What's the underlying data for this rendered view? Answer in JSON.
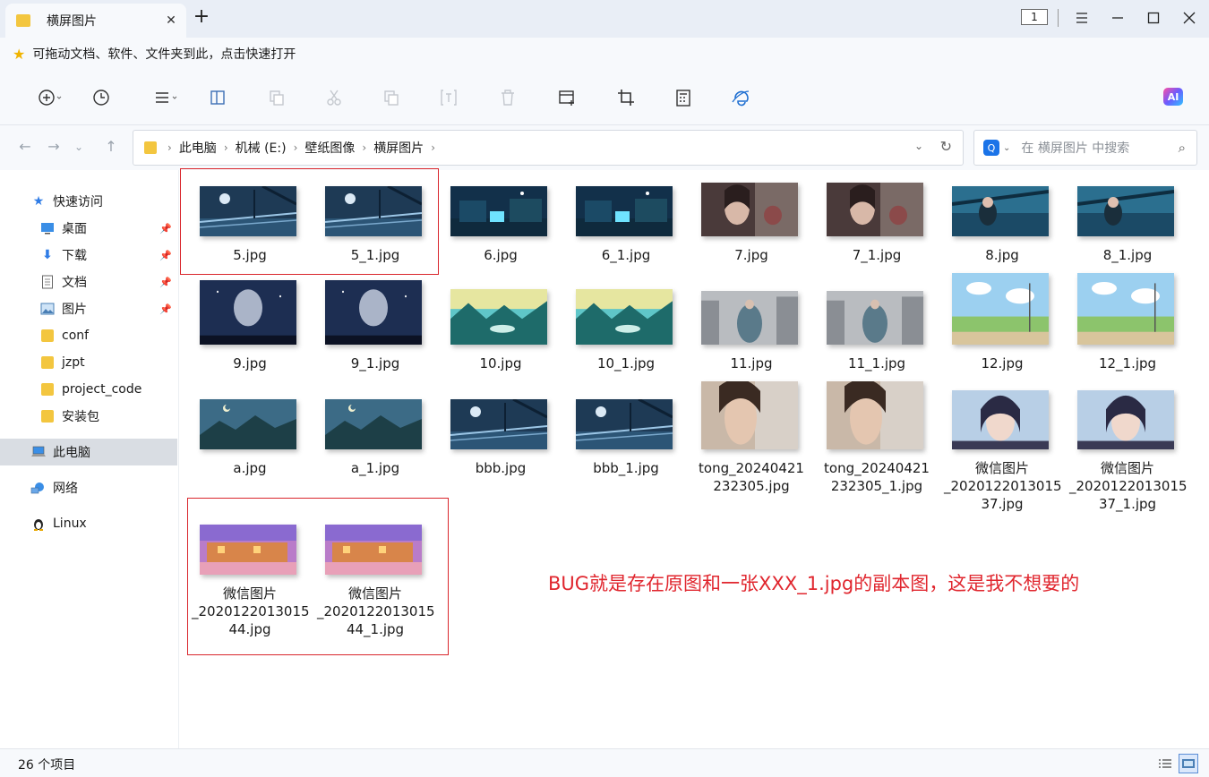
{
  "window": {
    "tab_title": "横屏图片",
    "page_counter": "1"
  },
  "quickbar": {
    "text": "可拖动文档、软件、文件夹到此，点击快速打开"
  },
  "toolbar": {
    "icons": [
      "new-icon",
      "history-icon",
      "view-menu-icon",
      "preview-pane-icon",
      "copy-icon",
      "cut-icon",
      "paste-icon",
      "rename-icon",
      "delete-icon",
      "new-window-icon",
      "crop-icon",
      "calculator-icon",
      "browser-icon"
    ],
    "ai_label": "AI"
  },
  "address": {
    "crumbs": [
      "此电脑",
      "机械 (E:)",
      "壁纸图像",
      "横屏图片"
    ],
    "search_placeholder": "在 横屏图片 中搜索"
  },
  "sidebar": {
    "items": [
      {
        "label": "快速访问",
        "icon": "star-icon"
      },
      {
        "label": "桌面",
        "icon": "desktop-icon",
        "pinned": true
      },
      {
        "label": "下载",
        "icon": "download-icon",
        "pinned": true
      },
      {
        "label": "文档",
        "icon": "document-icon",
        "pinned": true
      },
      {
        "label": "图片",
        "icon": "picture-icon",
        "pinned": true
      },
      {
        "label": "conf",
        "icon": "folder-icon"
      },
      {
        "label": "jzpt",
        "icon": "folder-icon"
      },
      {
        "label": "project_code",
        "icon": "folder-icon"
      },
      {
        "label": "安装包",
        "icon": "folder-icon"
      },
      {
        "label": "此电脑",
        "icon": "computer-icon",
        "selected": true
      },
      {
        "label": "网络",
        "icon": "network-icon"
      },
      {
        "label": "Linux",
        "icon": "linux-icon"
      }
    ]
  },
  "files": [
    {
      "name": "5.jpg",
      "theme": "train"
    },
    {
      "name": "5_1.jpg",
      "theme": "train"
    },
    {
      "name": "6.jpg",
      "theme": "night-street"
    },
    {
      "name": "6_1.jpg",
      "theme": "night-street"
    },
    {
      "name": "7.jpg",
      "theme": "girl-mech"
    },
    {
      "name": "7_1.jpg",
      "theme": "girl-mech"
    },
    {
      "name": "8.jpg",
      "theme": "blue-girl"
    },
    {
      "name": "8_1.jpg",
      "theme": "blue-girl"
    },
    {
      "name": "9.jpg",
      "theme": "moon"
    },
    {
      "name": "9_1.jpg",
      "theme": "moon"
    },
    {
      "name": "10.jpg",
      "theme": "lake"
    },
    {
      "name": "10_1.jpg",
      "theme": "lake"
    },
    {
      "name": "11.jpg",
      "theme": "city-girl"
    },
    {
      "name": "11_1.jpg",
      "theme": "city-girl"
    },
    {
      "name": "12.jpg",
      "theme": "sky-field"
    },
    {
      "name": "12_1.jpg",
      "theme": "sky-field"
    },
    {
      "name": "a.jpg",
      "theme": "mountain"
    },
    {
      "name": "a_1.jpg",
      "theme": "mountain"
    },
    {
      "name": "bbb.jpg",
      "theme": "train"
    },
    {
      "name": "bbb_1.jpg",
      "theme": "train"
    },
    {
      "name": "tong_20240421\n232305.jpg",
      "theme": "portrait"
    },
    {
      "name": "tong_20240421\n232305_1.jpg",
      "theme": "portrait"
    },
    {
      "name": "微信图片\n_2020122013015\n37.jpg",
      "theme": "anime-girl"
    },
    {
      "name": "微信图片\n_2020122013015\n37_1.jpg",
      "theme": "anime-girl"
    },
    {
      "name": "微信图片\n_2020122013015\n44.jpg",
      "theme": "sunset-town"
    },
    {
      "name": "微信图片\n_2020122013015\n44_1.jpg",
      "theme": "sunset-town"
    }
  ],
  "annotation": "BUG就是存在原图和一张XXX_1.jpg的副本图，这是我不想要的",
  "status": {
    "count": "26 个项目"
  }
}
